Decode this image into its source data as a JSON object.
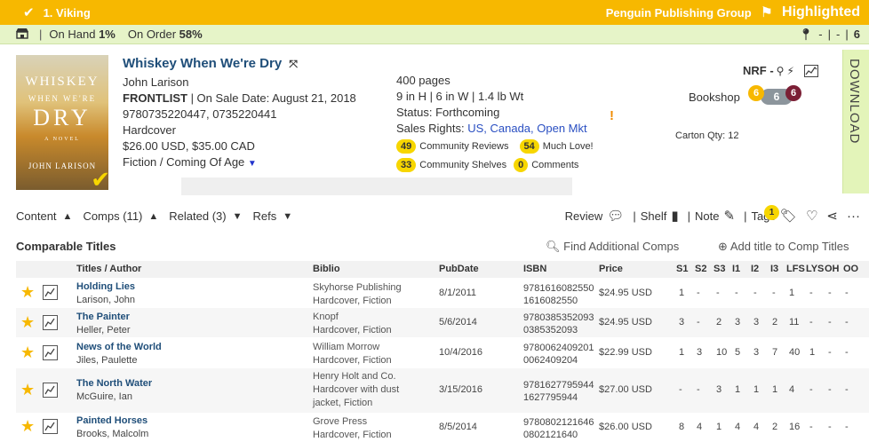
{
  "topbar": {
    "rank": "1. Viking",
    "publisher": "Penguin Publishing Group",
    "status": "Highlighted"
  },
  "inventory": {
    "on_hand_label": "On Hand",
    "on_hand_value": "1%",
    "on_order_label": "On Order",
    "on_order_value": "58%",
    "right": [
      "-",
      "|",
      "-",
      "|",
      "6"
    ]
  },
  "cover": {
    "title_top": "WHISKEY",
    "title_mid": "WHEN WE'RE",
    "title_big": "DRY",
    "subtitle": "A NOVEL",
    "author": "JOHN LARISON"
  },
  "book": {
    "title": "Whiskey When We're Dry",
    "author": "John Larison",
    "frontlist": "FRONTLIST",
    "sale_date": "| On Sale Date: August 21, 2018",
    "isbns": "9780735220447, 0735220441",
    "format": "Hardcover",
    "price": "$26.00 USD, $35.00 CAD",
    "category": "Fiction / Coming Of Age",
    "pages": "400 pages",
    "dimensions": "9 in H | 6 in W | 1.4 lb Wt",
    "status": "Status: Forthcoming",
    "sales_rights_label": "Sales Rights:",
    "sales_rights": "US, Canada, Open Mkt",
    "warning": "!"
  },
  "community": {
    "reviews_count": "49",
    "reviews_label": "Community Reviews",
    "love_count": "54",
    "love_label": "Much Love!",
    "shelves_count": "33",
    "shelves_label": "Community Shelves",
    "comments_count": "0",
    "comments_label": "Comments"
  },
  "right_panel": {
    "nrf": "NRF -",
    "bookshop": "Bookshop",
    "badge_left": "6",
    "badge_mid": "6",
    "badge_right": "6",
    "carton": "Carton Qty: 12",
    "download": "DOWNLOAD"
  },
  "tabs": [
    {
      "label": "Content"
    },
    {
      "label": "Comps (11)"
    },
    {
      "label": "Related (3)"
    },
    {
      "label": "Refs"
    }
  ],
  "actions": {
    "review": "Review",
    "shelf": "Shelf",
    "note": "Note",
    "tags": "Tags",
    "tag_count": "1"
  },
  "comps": {
    "title": "Comparable Titles",
    "find": "Find Additional Comps",
    "add": "Add title to Comp Titles",
    "headers": [
      "Titles / Author",
      "Biblio",
      "PubDate",
      "ISBN",
      "Price",
      "S1",
      "S2",
      "S3",
      "I1",
      "I2",
      "I3",
      "LFS",
      "LYS",
      "OH",
      "OO"
    ],
    "rows": [
      {
        "title": "Holding Lies",
        "author": "Larison, John",
        "biblio": [
          "Skyhorse Publishing",
          "Hardcover, Fiction"
        ],
        "pubdate": "8/1/2011",
        "isbn": [
          "9781616082550",
          "1616082550"
        ],
        "price": "$24.95 USD",
        "nums": [
          "1",
          "-",
          "-",
          "-",
          "-",
          "-",
          "1",
          "-",
          "-",
          "-"
        ]
      },
      {
        "title": "The Painter",
        "author": "Heller, Peter",
        "biblio": [
          "Knopf",
          "Hardcover, Fiction"
        ],
        "pubdate": "5/6/2014",
        "isbn": [
          "9780385352093",
          "0385352093"
        ],
        "price": "$24.95 USD",
        "nums": [
          "3",
          "-",
          "2",
          "3",
          "3",
          "2",
          "11",
          "-",
          "-",
          "-"
        ]
      },
      {
        "title": "News of the World",
        "author": "Jiles, Paulette",
        "biblio": [
          "William Morrow",
          "Hardcover, Fiction"
        ],
        "pubdate": "10/4/2016",
        "isbn": [
          "9780062409201",
          "0062409204"
        ],
        "price": "$22.99 USD",
        "nums": [
          "1",
          "3",
          "10",
          "5",
          "3",
          "7",
          "40",
          "1",
          "-",
          "-"
        ]
      },
      {
        "title": "The North Water",
        "author": "McGuire, Ian",
        "biblio": [
          "Henry Holt and Co.",
          "Hardcover with dust",
          "jacket, Fiction"
        ],
        "pubdate": "3/15/2016",
        "isbn": [
          "9781627795944",
          "1627795944"
        ],
        "price": "$27.00 USD",
        "nums": [
          "-",
          "-",
          "3",
          "1",
          "1",
          "1",
          "4",
          "-",
          "-",
          "-"
        ]
      },
      {
        "title": "Painted Horses",
        "author": "Brooks, Malcolm",
        "biblio": [
          "Grove Press",
          "Hardcover, Fiction"
        ],
        "pubdate": "8/5/2014",
        "isbn": [
          "9780802121646",
          "0802121640"
        ],
        "price": "$26.00 USD",
        "nums": [
          "8",
          "4",
          "1",
          "4",
          "4",
          "2",
          "16",
          "-",
          "-",
          "-"
        ]
      }
    ]
  }
}
